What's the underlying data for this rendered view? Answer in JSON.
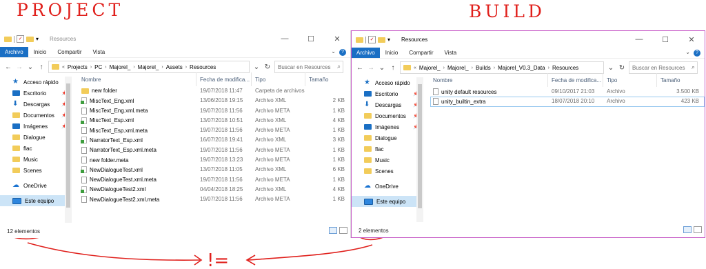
{
  "annotations": {
    "left_label": "PROJECT",
    "right_label": "BUILD",
    "inequality": "!="
  },
  "left": {
    "title": "Resources",
    "window_controls": [
      "—",
      "☐",
      "✕"
    ],
    "ribbon_tabs": [
      "Archivo",
      "Inicio",
      "Compartir",
      "Vista"
    ],
    "breadcrumb": [
      "Projects",
      "PC",
      "Majorel_",
      "Majorel_",
      "Assets",
      "Resources"
    ],
    "search_placeholder": "Buscar en Resources",
    "columns": [
      "Nombre",
      "Fecha de modifica...",
      "Tipo",
      "Tamaño"
    ],
    "files": [
      {
        "name": "new folder",
        "date": "19/07/2018 11:47",
        "type": "Carpeta de archivos",
        "size": "",
        "icon": "folder-icon"
      },
      {
        "name": "MiscText_Eng.xml",
        "date": "13/06/2018 19:15",
        "type": "Archivo XML",
        "size": "2 KB",
        "icon": "xml-file-icon"
      },
      {
        "name": "MiscText_Eng.xml.meta",
        "date": "19/07/2018 11:56",
        "type": "Archivo META",
        "size": "1 KB",
        "icon": "file-icon"
      },
      {
        "name": "MiscText_Esp.xml",
        "date": "13/07/2018 10:51",
        "type": "Archivo XML",
        "size": "4 KB",
        "icon": "xml-file-icon"
      },
      {
        "name": "MiscText_Esp.xml.meta",
        "date": "19/07/2018 11:56",
        "type": "Archivo META",
        "size": "1 KB",
        "icon": "file-icon"
      },
      {
        "name": "NarratorText_Esp.xml",
        "date": "16/07/2018 19:41",
        "type": "Archivo XML",
        "size": "3 KB",
        "icon": "xml-file-icon"
      },
      {
        "name": "NarratorText_Esp.xml.meta",
        "date": "19/07/2018 11:56",
        "type": "Archivo META",
        "size": "1 KB",
        "icon": "file-icon"
      },
      {
        "name": "new folder.meta",
        "date": "19/07/2018 13:23",
        "type": "Archivo META",
        "size": "1 KB",
        "icon": "file-icon"
      },
      {
        "name": "NewDialogueTest.xml",
        "date": "13/07/2018 11:05",
        "type": "Archivo XML",
        "size": "6 KB",
        "icon": "xml-file-icon"
      },
      {
        "name": "NewDialogueTest.xml.meta",
        "date": "19/07/2018 11:56",
        "type": "Archivo META",
        "size": "1 KB",
        "icon": "file-icon"
      },
      {
        "name": "NewDialogueTest2.xml",
        "date": "04/04/2018 18:25",
        "type": "Archivo XML",
        "size": "4 KB",
        "icon": "xml-file-icon"
      },
      {
        "name": "NewDialogueTest2.xml.meta",
        "date": "19/07/2018 11:56",
        "type": "Archivo META",
        "size": "1 KB",
        "icon": "file-icon"
      }
    ],
    "status": "12 elementos"
  },
  "right": {
    "title": "Resources",
    "window_controls": [
      "—",
      "☐",
      "✕"
    ],
    "ribbon_tabs": [
      "Archivo",
      "Inicio",
      "Compartir",
      "Vista"
    ],
    "breadcrumb": [
      "Majorel_",
      "Majorel_",
      "Builds",
      "Majorel_V0.3_Data",
      "Resources"
    ],
    "search_placeholder": "Buscar en Resources",
    "columns": [
      "Nombre",
      "Fecha de modifica...",
      "Tipo",
      "Tamaño"
    ],
    "files": [
      {
        "name": "unity default resources",
        "date": "09/10/2017 21:03",
        "type": "Archivo",
        "size": "3.500 KB",
        "icon": "file-icon"
      },
      {
        "name": "unity_builtin_extra",
        "date": "18/07/2018 20:10",
        "type": "Archivo",
        "size": "423 KB",
        "icon": "file-icon"
      }
    ],
    "status": "2 elementos"
  },
  "nav_items": [
    {
      "label": "Acceso rápido",
      "icon": "star-icon",
      "pinned": false
    },
    {
      "label": "Escritorio",
      "icon": "desktop-icon",
      "pinned": true
    },
    {
      "label": "Descargas",
      "icon": "download-icon",
      "pinned": true
    },
    {
      "label": "Documentos",
      "icon": "documents-icon",
      "pinned": true
    },
    {
      "label": "Imágenes",
      "icon": "pictures-icon",
      "pinned": true
    },
    {
      "label": "Dialogue",
      "icon": "folder-icon",
      "pinned": false
    },
    {
      "label": "flac",
      "icon": "folder-icon",
      "pinned": false
    },
    {
      "label": "Music",
      "icon": "folder-icon",
      "pinned": false
    },
    {
      "label": "Scenes",
      "icon": "folder-icon",
      "pinned": false
    },
    {
      "label": "OneDrive",
      "icon": "cloud-icon",
      "pinned": false
    },
    {
      "label": "Este equipo",
      "icon": "pc-icon",
      "pinned": false
    }
  ],
  "colors": {
    "accent": "#1a6fc4",
    "annotation": "#e0201c",
    "right_border": "#c75bc7"
  }
}
